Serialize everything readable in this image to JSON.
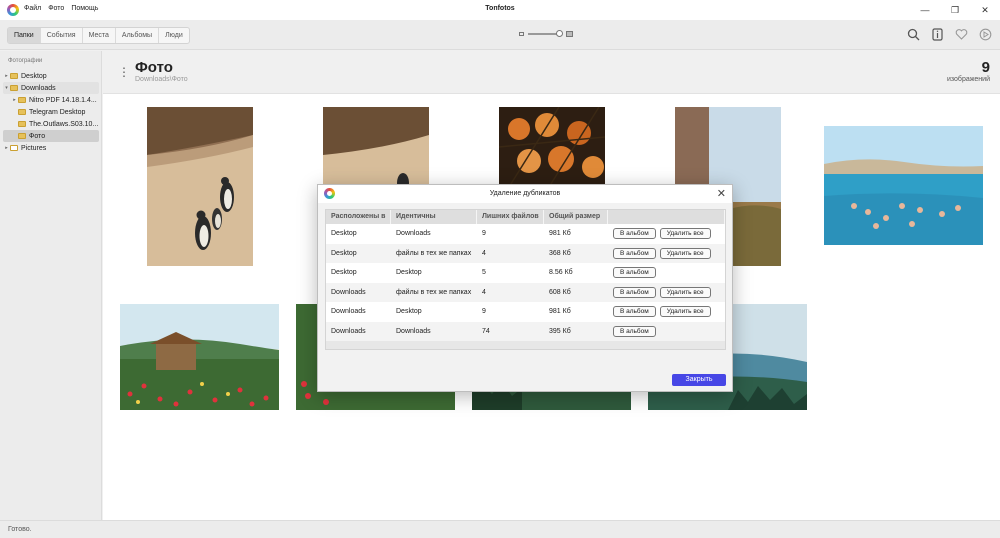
{
  "app": {
    "title": "Tonfotos"
  },
  "menu": {
    "file": "Файл",
    "photo": "Фото",
    "help": "Помощь"
  },
  "tabs": [
    "Папки",
    "События",
    "Места",
    "Альбомы",
    "Люди"
  ],
  "sidebar": {
    "header": "Фотографии",
    "items": [
      {
        "label": "Desktop"
      },
      {
        "label": "Downloads"
      },
      {
        "label": "Nitro PDF 14.18.1.4..."
      },
      {
        "label": "Telegram Desktop"
      },
      {
        "label": "The.Outlaws.S03.10..."
      },
      {
        "label": "Фото"
      },
      {
        "label": "Pictures"
      }
    ]
  },
  "main": {
    "title": "Фото",
    "path": "Downloads\\Фото",
    "count": "9",
    "count_label": "изображений"
  },
  "status": {
    "text": "Готово."
  },
  "dialog": {
    "title": "Удаление дубликатов",
    "headers": [
      "Расположены в",
      "Идентичны",
      "Лишних файлов",
      "Общий размер"
    ],
    "rows": [
      {
        "location": "Desktop",
        "identical": "Downloads",
        "extra": "9",
        "size": "981 Кб",
        "album": "В альбом",
        "delete": "Удалить все"
      },
      {
        "location": "Desktop",
        "identical": "файлы в тех же папках",
        "extra": "4",
        "size": "368 Кб",
        "album": "В альбом",
        "delete": "Удалить все"
      },
      {
        "location": "Desktop",
        "identical": "Desktop",
        "extra": "5",
        "size": "8.56 Кб",
        "album": "В альбом"
      },
      {
        "location": "Downloads",
        "identical": "файлы в тех же папках",
        "extra": "4",
        "size": "608 Кб",
        "album": "В альбом",
        "delete": "Удалить все"
      },
      {
        "location": "Downloads",
        "identical": "Desktop",
        "extra": "9",
        "size": "981 Кб",
        "album": "В альбом",
        "delete": "Удалить все"
      },
      {
        "location": "Downloads",
        "identical": "Downloads",
        "extra": "74",
        "size": "395 Кб",
        "album": "В альбом"
      }
    ],
    "close_label": "Закрыть"
  }
}
